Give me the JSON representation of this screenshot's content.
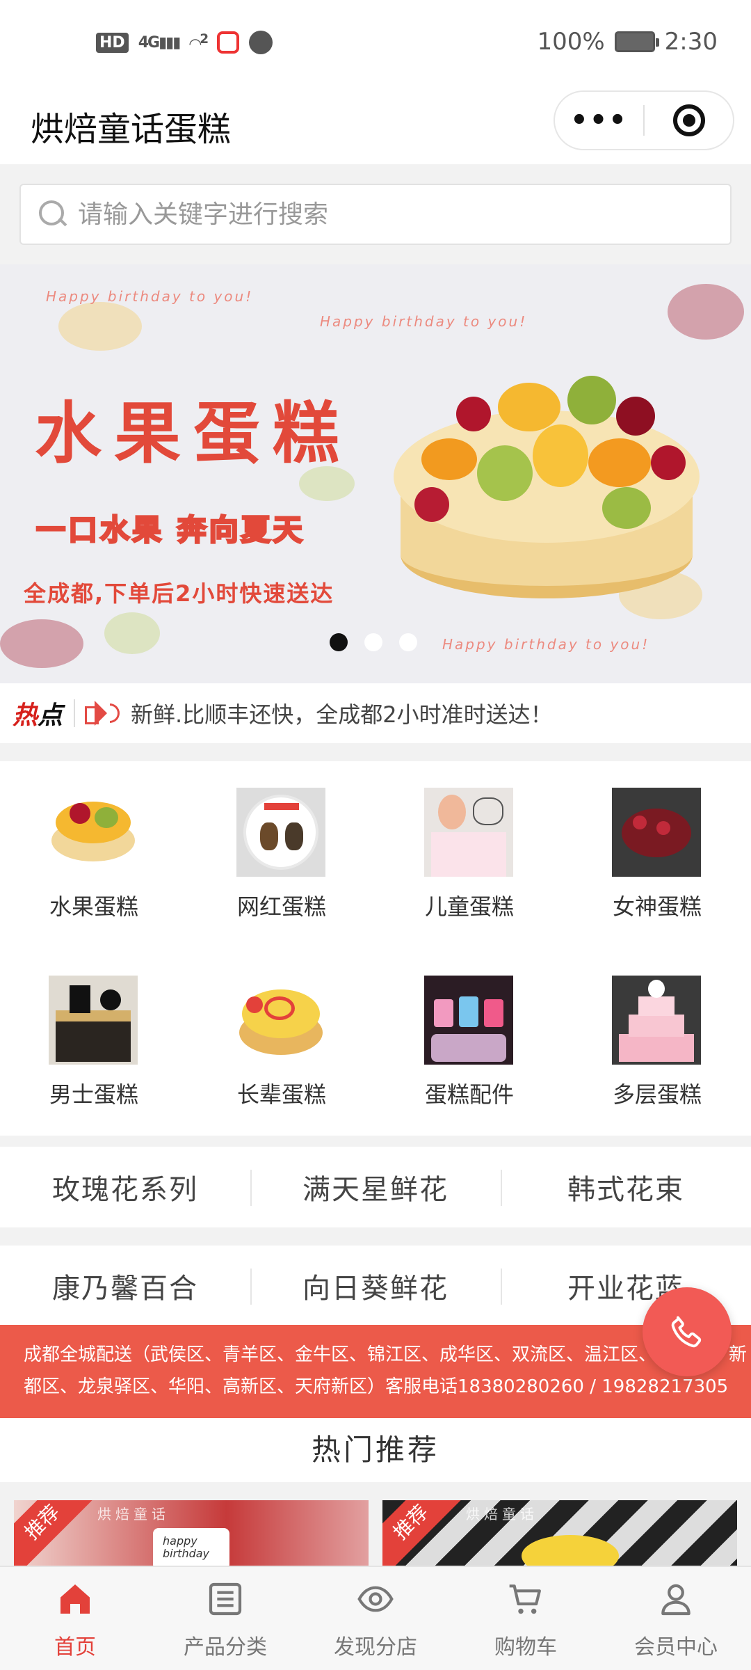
{
  "status_bar": {
    "hd": "HD",
    "network": "4G",
    "hotspot_count": "2",
    "battery_percent": "100%",
    "time": "2:30"
  },
  "header": {
    "title": "烘焙童话蛋糕",
    "more_glyph": "•••"
  },
  "search": {
    "placeholder": "请输入关键字进行搜索",
    "value": ""
  },
  "banner": {
    "title": "水果蛋糕",
    "subtitle": "一口水果  奔向夏天",
    "delivery": "全成都,下单后2小时快速送达",
    "greeting": "Happy birthday to you!",
    "active_slide": 1,
    "slide_count": 3
  },
  "hot_news": {
    "label_a": "热",
    "label_b": "点",
    "text": "新鲜.比顺丰还快，全成都2小时准时送达！"
  },
  "categories": [
    {
      "label": "水果蛋糕",
      "icon": "fruit-cake-image"
    },
    {
      "label": "网红蛋糕",
      "icon": "trendy-cake-image"
    },
    {
      "label": "儿童蛋糕",
      "icon": "kids-cake-image"
    },
    {
      "label": "女神蛋糕",
      "icon": "goddess-cake-image"
    },
    {
      "label": "男士蛋糕",
      "icon": "mens-cake-image"
    },
    {
      "label": "长辈蛋糕",
      "icon": "elder-cake-image"
    },
    {
      "label": "蛋糕配件",
      "icon": "candles-image"
    },
    {
      "label": "多层蛋糕",
      "icon": "tiered-cake-image"
    }
  ],
  "flower_tabs_row1": [
    "玫瑰花系列",
    "满天星鲜花",
    "韩式花束"
  ],
  "flower_tabs_row2": [
    "康乃馨百合",
    "向日葵鲜花",
    "开业花蓝"
  ],
  "notice": {
    "line1": "成都全城配送（武侯区、青羊区、金牛区、锦江区、成华区、双流区、温江区、郫都区、新",
    "line2": "都区、龙泉驿区、华阳、高新区、天府新区）客服电话18380280260 / 19828217305"
  },
  "recommend": {
    "title": "热门推荐",
    "tag": "推荐",
    "brand": "烘焙童话",
    "card1_text": "happy birthday"
  },
  "bottom_nav": [
    {
      "label": "首页",
      "icon": "home-icon",
      "active": true
    },
    {
      "label": "产品分类",
      "icon": "list-icon",
      "active": false
    },
    {
      "label": "发现分店",
      "icon": "eye-icon",
      "active": false
    },
    {
      "label": "购物车",
      "icon": "cart-icon",
      "active": false
    },
    {
      "label": "会员中心",
      "icon": "user-icon",
      "active": false
    }
  ],
  "colors": {
    "accent": "#e3413a",
    "notice_bg": "#ec5a4a",
    "banner_red": "#e2493a"
  }
}
